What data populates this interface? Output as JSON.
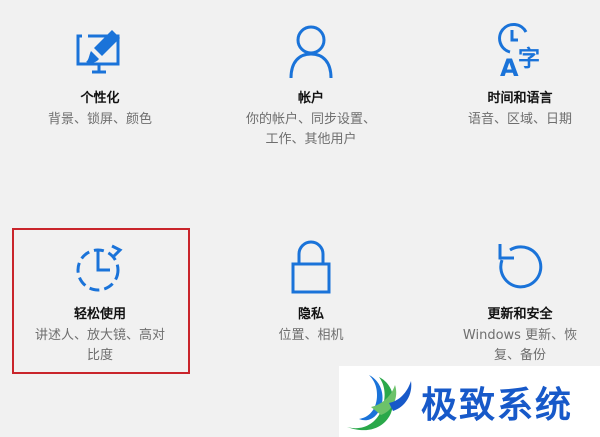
{
  "colors": {
    "accent": "#1a73d9",
    "highlight_border": "#c9242b",
    "watermark_text": "#1759c9"
  },
  "tiles": [
    {
      "title": "个性化",
      "desc": [
        "背景、锁屏、颜色"
      ],
      "icon": "personalization-icon"
    },
    {
      "title": "帐户",
      "desc": [
        "你的帐户、同步设置、",
        "工作、其他用户"
      ],
      "icon": "account-icon"
    },
    {
      "title": "时间和语言",
      "desc": [
        "语音、区域、日期"
      ],
      "icon": "time-language-icon"
    },
    {
      "title": "轻松使用",
      "desc": [
        "讲述人、放大镜、高对",
        "比度"
      ],
      "icon": "ease-of-access-icon"
    },
    {
      "title": "隐私",
      "desc": [
        "位置、相机"
      ],
      "icon": "privacy-lock-icon"
    },
    {
      "title": "更新和安全",
      "desc": [
        "Windows 更新、恢",
        "复、备份"
      ],
      "icon": "update-security-icon"
    }
  ],
  "watermark": {
    "text": "极致系统"
  }
}
